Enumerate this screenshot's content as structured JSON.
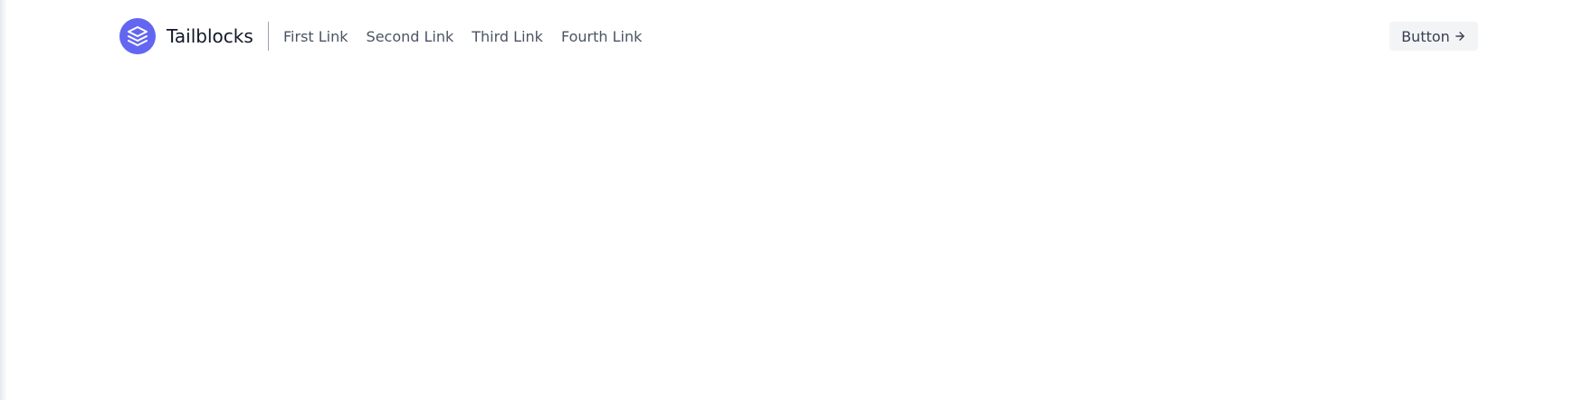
{
  "brand": {
    "name": "Tailblocks",
    "logo_icon": "stack-layers-icon",
    "logo_color": "#6366f1"
  },
  "nav": {
    "links": [
      "First Link",
      "Second Link",
      "Third Link",
      "Fourth Link"
    ]
  },
  "cta": {
    "label": "Button",
    "icon": "arrow-right-icon"
  }
}
